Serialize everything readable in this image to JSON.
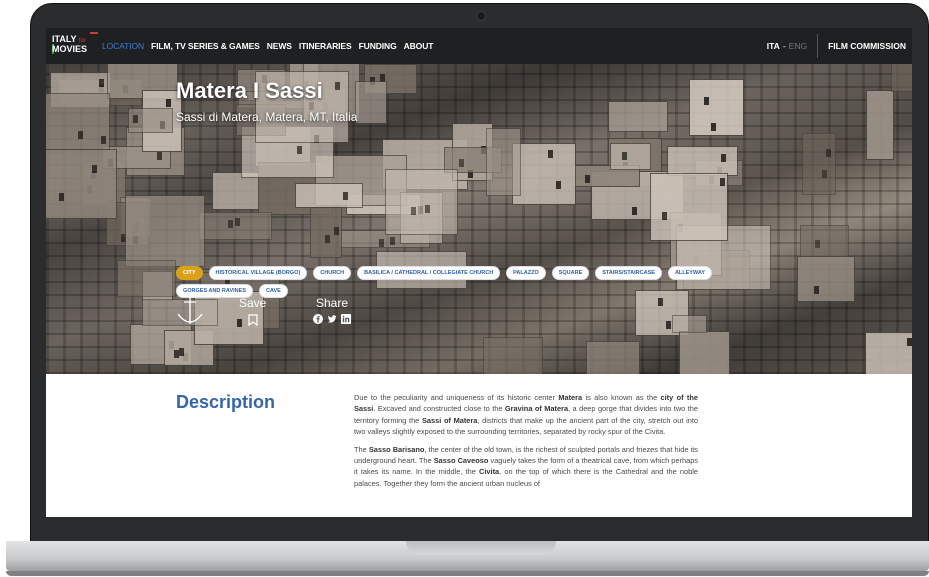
{
  "nav": {
    "logo_line1": "ITALY",
    "logo_for": "for",
    "logo_line2": "MOVIES",
    "items": [
      {
        "label": "LOCATION",
        "active": true
      },
      {
        "label": "FILM, TV SERIES & GAMES",
        "active": false
      },
      {
        "label": "NEWS",
        "active": false
      },
      {
        "label": "ITINERARIES",
        "active": false
      },
      {
        "label": "FUNDING",
        "active": false
      },
      {
        "label": "ABOUT",
        "active": false
      }
    ],
    "lang_active": "ITA",
    "lang_separator": "-",
    "lang_inactive": "ENG",
    "film_commission": "FILM COMMISSION"
  },
  "hero": {
    "title": "Matera I Sassi",
    "subtitle": "Sassi di Matera, Matera, MT, Italia",
    "tags": [
      {
        "label": "CITY",
        "active": true
      },
      {
        "label": "HISTORICAL VILLAGE (BORGO)",
        "active": false
      },
      {
        "label": "CHURCH",
        "active": false
      },
      {
        "label": "BASILICA / CATHEDRAL / COLLEGIATE CHURCH",
        "active": false
      },
      {
        "label": "PALAZZO",
        "active": false
      },
      {
        "label": "SQUARE",
        "active": false
      },
      {
        "label": "STAIRS/STAIRCASE",
        "active": false
      },
      {
        "label": "ALLEYWAY",
        "active": false
      },
      {
        "label": "GORGES AND RAVINES",
        "active": false
      },
      {
        "label": "CAVE",
        "active": false
      }
    ],
    "save_label": "Save",
    "share_label": "Share"
  },
  "description": {
    "heading": "Description",
    "p1": [
      {
        "t": "Due to the peculiarity and uniqueness of its historic center ",
        "b": false
      },
      {
        "t": "Matera",
        "b": true
      },
      {
        "t": " is also known as the ",
        "b": false
      },
      {
        "t": "city of the Sassi",
        "b": true
      },
      {
        "t": ". Excaved and constructed close to the ",
        "b": false
      },
      {
        "t": "Gravina of Matera",
        "b": true
      },
      {
        "t": ", a deep gorge that divides into two the territory forming the ",
        "b": false
      },
      {
        "t": "Sassi of Matera",
        "b": true
      },
      {
        "t": ", districts that make up the ancient part of the city, stretch out into two valleys slightly exposed to the surrounding territories, separated by rocky spur of the Civita.",
        "b": false
      }
    ],
    "p2": [
      {
        "t": "The ",
        "b": false
      },
      {
        "t": "Sasso Barisano",
        "b": true
      },
      {
        "t": ", the center of the old town, is the richest of sculpted portals and friezes that hide its underground heart. The ",
        "b": false
      },
      {
        "t": "Sasso Caveoso",
        "b": true
      },
      {
        "t": " vaguely takes the form of a theatrical cave, from which perhaps it takes its name. In the middle, the ",
        "b": false
      },
      {
        "t": "Civita",
        "b": true
      },
      {
        "t": ", on the top of which there is the Cathedral and the noble palaces. Together they form the ancient urban nucleus of",
        "b": false
      }
    ]
  },
  "icons": {
    "anchor": "anchor-icon",
    "save": "bookmark-icon",
    "share": [
      "facebook-icon",
      "twitter-icon",
      "linkedin-icon"
    ]
  },
  "colors": {
    "nav_bg": "#1f2022",
    "active_link": "#3b7bd6",
    "tag_active": "#d9a21b",
    "heading": "#3565a8"
  }
}
